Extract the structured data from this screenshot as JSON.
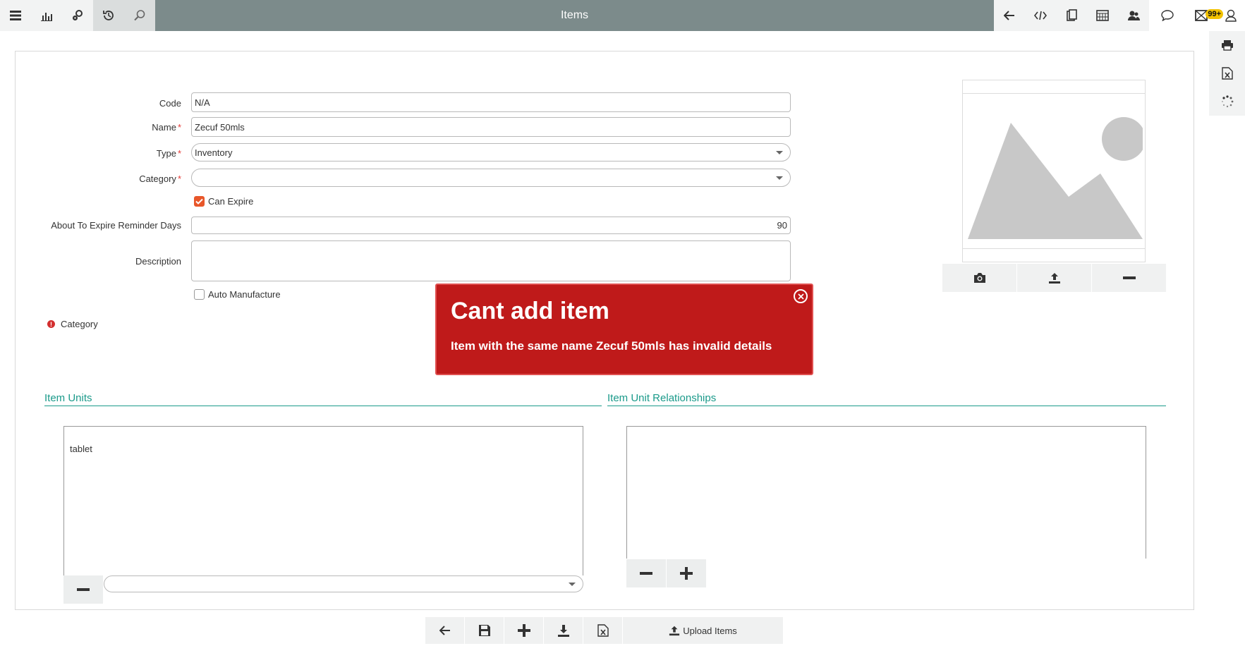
{
  "topbar": {
    "title": "Items",
    "badge": "99+"
  },
  "form": {
    "code": {
      "label": "Code",
      "value": "N/A"
    },
    "name": {
      "label": "Name",
      "value": "Zecuf 50mls",
      "required": "*"
    },
    "type": {
      "label": "Type",
      "value": "Inventory",
      "required": "*"
    },
    "category": {
      "label": "Category",
      "value": "",
      "required": "*"
    },
    "can_expire": {
      "label": "Can Expire",
      "checked": true
    },
    "reminder_days": {
      "label": "About To Expire Reminder Days",
      "value": "90"
    },
    "description": {
      "label": "Description",
      "value": ""
    },
    "auto_manufacture": {
      "label": "Auto Manufacture",
      "checked": false
    }
  },
  "validation": {
    "icon": "!",
    "message": "Category"
  },
  "sections": {
    "item_units": "Item Units",
    "item_unit_relationships": "Item Unit Relationships"
  },
  "item_units": {
    "items": [
      "tablet"
    ],
    "unit_select_value": ""
  },
  "toast": {
    "title": "Cant add item",
    "message": "Item with the same name Zecuf 50mls has invalid details"
  },
  "bottom_bar": {
    "upload_label": "Upload Items"
  },
  "colors": {
    "title_bar": "#7c8b8b",
    "accent": "#1a9a8a",
    "error": "#bf1a1a",
    "checkbox": "#e8572a"
  }
}
